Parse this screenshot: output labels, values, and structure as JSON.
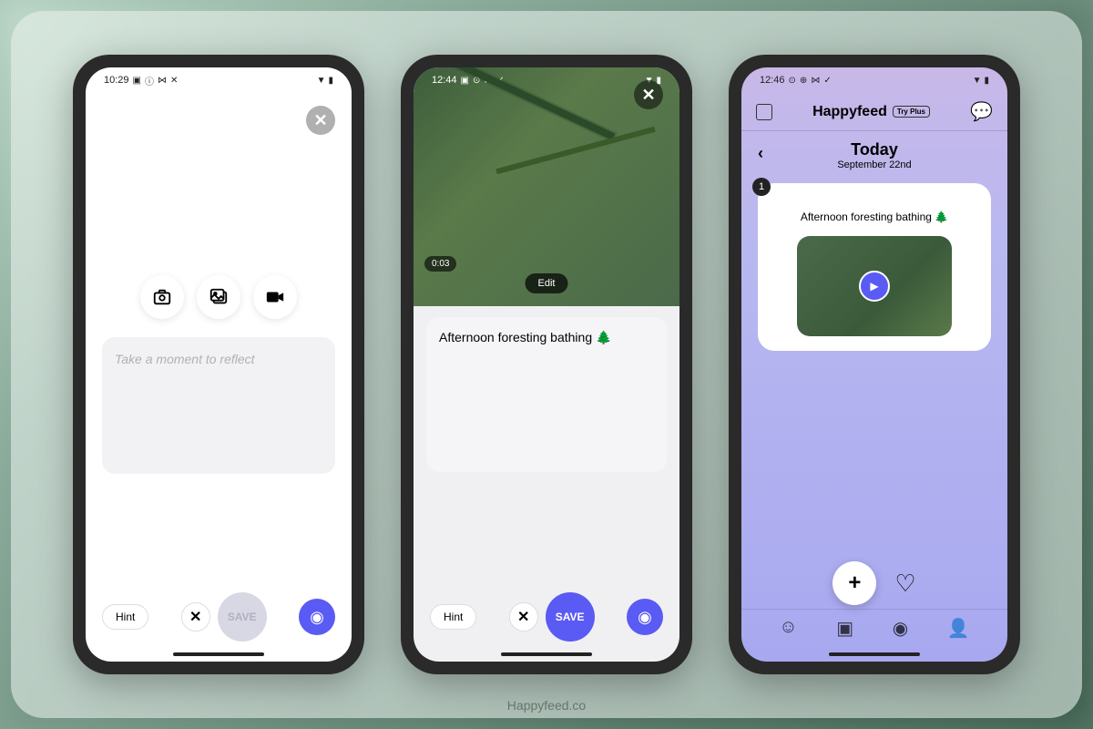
{
  "watermark": "Happyfeed.co",
  "screen1": {
    "time": "10:29",
    "placeholder": "Take a moment to reflect",
    "hint": "Hint",
    "save": "SAVE"
  },
  "screen2": {
    "time": "12:44",
    "video_duration": "0:03",
    "edit": "Edit",
    "entry_text": "Afternoon foresting bathing 🌲",
    "hint": "Hint",
    "save": "SAVE"
  },
  "screen3": {
    "time": "12:46",
    "app_name": "Happyfeed",
    "try_plus": "Try Plus",
    "date_title": "Today",
    "date_sub": "September 22nd",
    "badge": "1",
    "entry_text": "Afternoon foresting bathing 🌲"
  }
}
